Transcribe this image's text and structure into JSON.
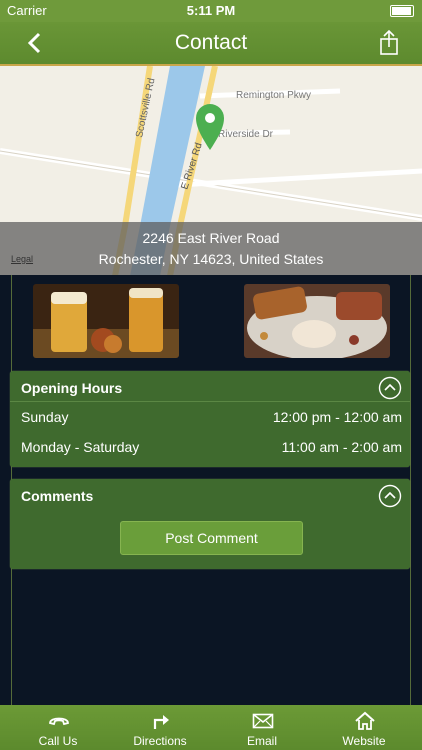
{
  "status_bar": {
    "carrier": "Carrier",
    "time": "5:11 PM"
  },
  "nav": {
    "title": "Contact",
    "back_icon": "chevron-left-icon",
    "share_icon": "share-icon"
  },
  "map": {
    "streets": [
      "Scottsville Rd",
      "Remington Pkwy",
      "Riverside Dr",
      "E River Rd"
    ],
    "legal": "Legal",
    "address_line1": "2246 East River Road",
    "address_line2": "Rochester, NY 14623, United States",
    "pin_color": "#4caf50"
  },
  "opening_hours": {
    "title": "Opening Hours",
    "rows": [
      {
        "day": "Sunday",
        "hours": "12:00 pm - 12:00 am"
      },
      {
        "day": "Monday - Saturday",
        "hours": "11:00 am - 2:00 am"
      }
    ]
  },
  "comments": {
    "title": "Comments",
    "button": "Post Comment"
  },
  "tabs": [
    {
      "label": "Call Us",
      "icon": "phone-icon"
    },
    {
      "label": "Directions",
      "icon": "directions-icon"
    },
    {
      "label": "Email",
      "icon": "email-icon"
    },
    {
      "label": "Website",
      "icon": "home-icon"
    }
  ],
  "colors": {
    "brand_green": "#5d8a2e",
    "gold_accent": "#c9a64a",
    "background": "#0b1524"
  }
}
